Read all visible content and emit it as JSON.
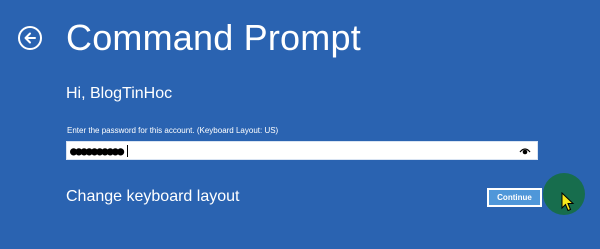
{
  "header": {
    "title": "Command Prompt",
    "back_icon": "back-arrow-icon"
  },
  "account": {
    "greeting": "Hi, BlogTinHoc",
    "instruction": "Enter the password for this account. (Keyboard Layout: US)"
  },
  "password": {
    "masked_value": "●●●●●●●●●●",
    "reveal_icon": "eye-icon"
  },
  "actions": {
    "change_keyboard_label": "Change keyboard layout",
    "continue_label": "Continue"
  },
  "colors": {
    "background": "#2a63b1",
    "button": "#4f97d9",
    "click_highlight": "#146e3c"
  }
}
